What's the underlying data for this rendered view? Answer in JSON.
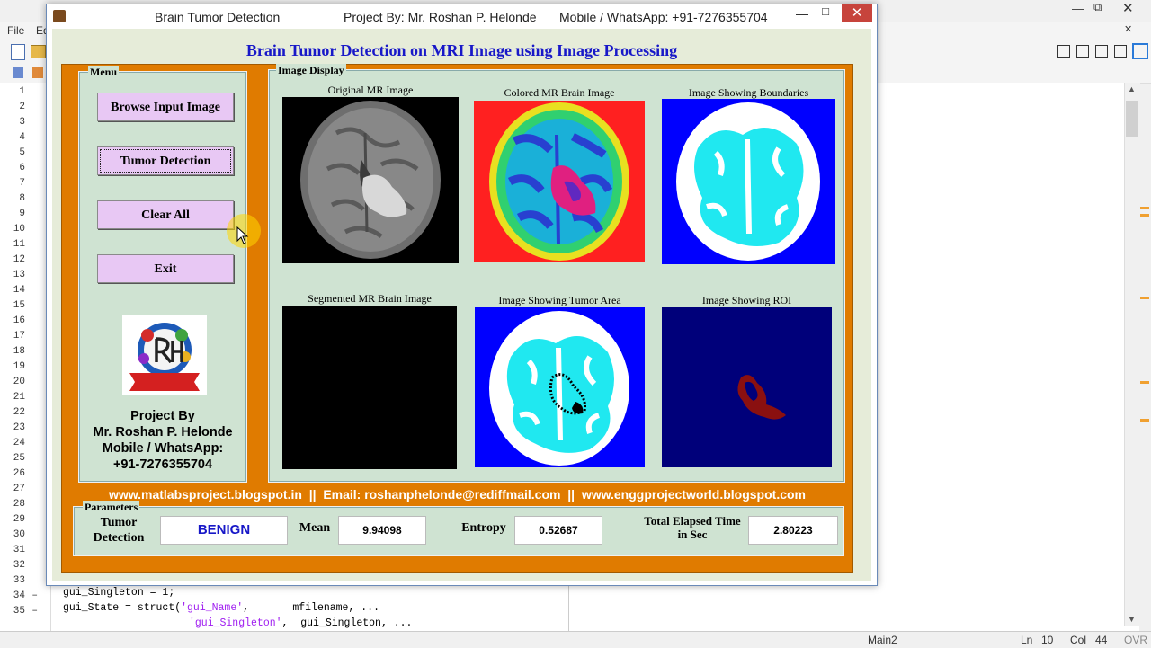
{
  "matlab": {
    "menu": [
      "File",
      "Ed"
    ],
    "line_numbers": [
      "1",
      "2",
      "3",
      "4",
      "5",
      "6",
      "7",
      "8",
      "9",
      "10",
      "11",
      "12",
      "13",
      "14",
      "15",
      "16",
      "17",
      "18",
      "19",
      "20",
      "21",
      "22",
      "23",
      "24",
      "25",
      "26",
      "27",
      "28",
      "29",
      "30",
      "31",
      "32",
      "33",
      "34",
      "35"
    ],
    "code": {
      "line34": "gui_Singleton = 1;",
      "line35_a": "gui_State = struct(",
      "line35_s1": "'gui_Name'",
      "line35_b": ",       mfilename, ...",
      "line36_s": "'gui_Singleton'",
      "line36_b": ",  gui_Singleton, ..."
    },
    "status": {
      "file": "Main2",
      "ln_label": "Ln",
      "ln": "10",
      "col_label": "Col",
      "col": "44",
      "mode": "OVR"
    }
  },
  "figure": {
    "title": "Brain Tumor Detection",
    "project_by": "Project By: Mr. Roshan P. Helonde",
    "mobile": "Mobile / WhatsApp: +91-7276355704",
    "heading": "Brain Tumor Detection on MRI Image using Image Processing",
    "menu": {
      "label": "Menu",
      "buttons": [
        "Browse Input Image",
        "Tumor Detection",
        "Clear All",
        "Exit"
      ],
      "credits": [
        "Project By",
        "Mr. Roshan P. Helonde",
        "Mobile / WhatsApp:",
        "+91-7276355704"
      ]
    },
    "display": {
      "label": "Image Display",
      "titles": [
        "Original MR Image",
        "Colored MR Brain Image",
        "Image Showing Boundaries",
        "Segmented MR Brain Image",
        "Image Showing Tumor Area",
        "Image Showing ROI"
      ]
    },
    "links": "www.matlabsproject.blogspot.in  ||  Email: roshanphelonde@rediffmail.com  ||  www.enggprojectworld.blogspot.com",
    "parameters": {
      "label": "Parameters",
      "tumor_label": "Tumor Detection",
      "tumor_value": "BENIGN",
      "mean_label": "Mean",
      "mean_value": "9.94098",
      "entropy_label": "Entropy",
      "entropy_value": "0.52687",
      "time_label": "Total Elapsed Time in Sec",
      "time_value": "2.80223"
    }
  },
  "colors": {
    "heading": "#1818c8",
    "tumor_value": "#1818c8",
    "frame": "#e07b00",
    "panel": "#cfe3d2",
    "button": "#e8c8f4"
  }
}
